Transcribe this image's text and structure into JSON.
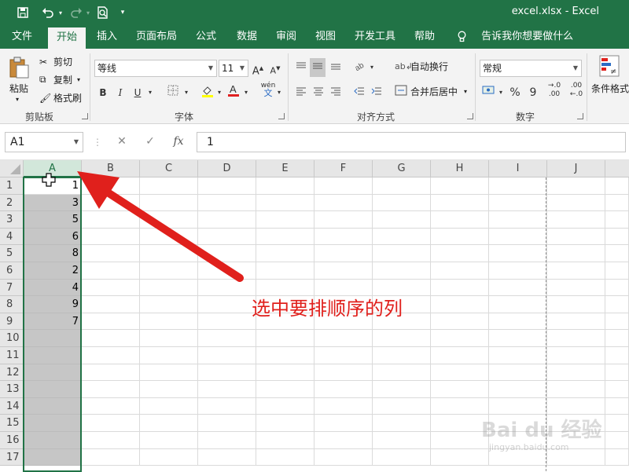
{
  "app": {
    "filename": "excel.xlsx",
    "app_name": "Excel",
    "title": "excel.xlsx  -  Excel"
  },
  "tabs": [
    {
      "label": "文件"
    },
    {
      "label": "开始",
      "active": true
    },
    {
      "label": "插入"
    },
    {
      "label": "页面布局"
    },
    {
      "label": "公式"
    },
    {
      "label": "数据"
    },
    {
      "label": "审阅"
    },
    {
      "label": "视图"
    },
    {
      "label": "开发工具"
    },
    {
      "label": "帮助"
    }
  ],
  "tell_me": "告诉我你想要做什么",
  "ribbon": {
    "clipboard": {
      "paste": "粘贴",
      "cut": "剪切",
      "copy": "复制",
      "format_painter": "格式刷",
      "label": "剪贴板"
    },
    "font": {
      "name": "等线",
      "size": "11",
      "grow": "A",
      "shrink": "A",
      "bold": "B",
      "italic": "I",
      "underline": "U",
      "wen": "wén",
      "wen2": "文",
      "label": "字体"
    },
    "alignment": {
      "wrap": "自动换行",
      "merge": "合并后居中",
      "label": "对齐方式"
    },
    "number": {
      "format": "常规",
      "percent": "%",
      "comma": "9",
      "inc": ".00",
      "dec": ".00",
      "inc_sub": "→.0",
      "dec_sub": "←.0",
      "label": "数字"
    },
    "styles": {
      "conditional": "条件格式"
    }
  },
  "formula_bar": {
    "name_box": "A1",
    "fx": "fx",
    "value": "1"
  },
  "sheet": {
    "columns": [
      "A",
      "B",
      "C",
      "D",
      "E",
      "F",
      "G",
      "H",
      "I",
      "J"
    ],
    "rows": [
      "1",
      "2",
      "3",
      "4",
      "5",
      "6",
      "7",
      "8",
      "9",
      "10",
      "11",
      "12",
      "13",
      "14",
      "15",
      "16",
      "17"
    ],
    "column_a_values": [
      "1",
      "3",
      "5",
      "6",
      "8",
      "2",
      "4",
      "9",
      "7",
      "",
      "",
      "",
      "",
      "",
      "",
      "",
      ""
    ]
  },
  "annotation": "选中要排顺序的列",
  "watermark": {
    "brand": "Bai du 经验",
    "url": "jingyan.baidu.com"
  },
  "colors": {
    "excel_green": "#217346",
    "annotation_red": "#e0201c"
  }
}
